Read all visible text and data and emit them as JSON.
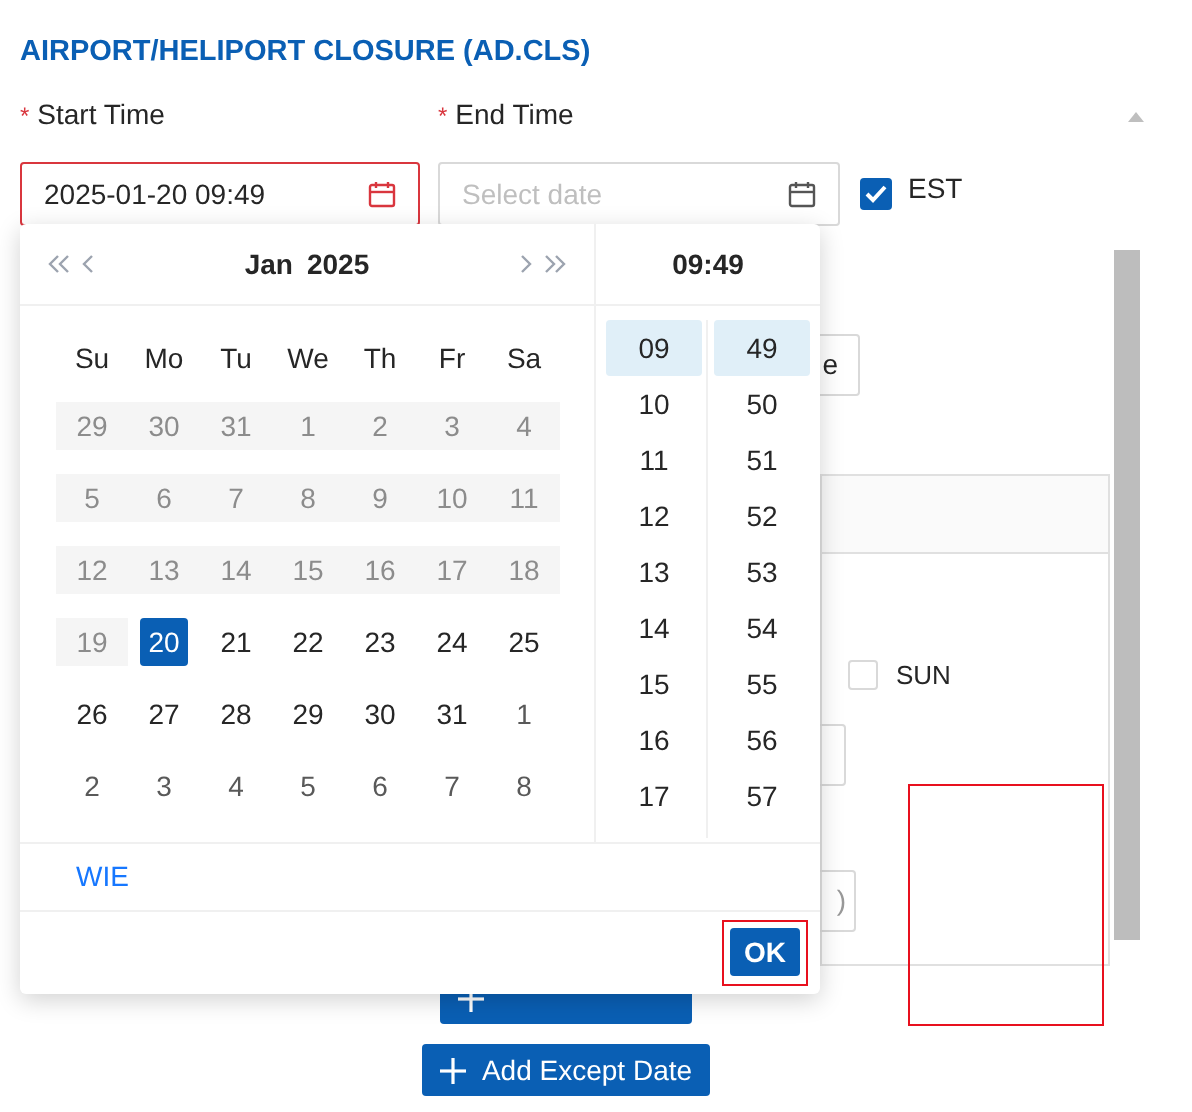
{
  "section": {
    "title": "AIRPORT/HELIPORT CLOSURE (AD.CLS)"
  },
  "fields": [
    {
      "label": "Start Time",
      "required_mark": "*",
      "value": "2025-01-20 09:49",
      "error": true
    },
    {
      "label": "End Time",
      "required_mark": "*",
      "placeholder": "Select date",
      "error": false
    }
  ],
  "est": {
    "label": "EST",
    "checked": true
  },
  "background": {
    "button_text": "e",
    "checkbox": {
      "label": "SUN",
      "checked": false
    },
    "field_text": ")"
  },
  "buttons": [
    {
      "label": "Add Except Date"
    }
  ],
  "picker": {
    "month": "Jan",
    "year": "2025",
    "time": "09:49",
    "weekdays": [
      "Su",
      "Mo",
      "Tu",
      "We",
      "Th",
      "Fr",
      "Sa"
    ],
    "weeks": [
      [
        {
          "day": "29",
          "kind": "disabled",
          "selected": false
        },
        {
          "day": "30",
          "kind": "disabled",
          "selected": false
        },
        {
          "day": "31",
          "kind": "disabled",
          "selected": false
        },
        {
          "day": "1",
          "kind": "disabled",
          "selected": false
        },
        {
          "day": "2",
          "kind": "disabled",
          "selected": false
        },
        {
          "day": "3",
          "kind": "disabled",
          "selected": false
        },
        {
          "day": "4",
          "kind": "disabled",
          "selected": false
        }
      ],
      [
        {
          "day": "5",
          "kind": "disabled",
          "selected": false
        },
        {
          "day": "6",
          "kind": "disabled",
          "selected": false
        },
        {
          "day": "7",
          "kind": "disabled",
          "selected": false
        },
        {
          "day": "8",
          "kind": "disabled",
          "selected": false
        },
        {
          "day": "9",
          "kind": "disabled",
          "selected": false
        },
        {
          "day": "10",
          "kind": "disabled",
          "selected": false
        },
        {
          "day": "11",
          "kind": "disabled",
          "selected": false
        }
      ],
      [
        {
          "day": "12",
          "kind": "disabled",
          "selected": false
        },
        {
          "day": "13",
          "kind": "disabled",
          "selected": false
        },
        {
          "day": "14",
          "kind": "disabled",
          "selected": false
        },
        {
          "day": "15",
          "kind": "disabled",
          "selected": false
        },
        {
          "day": "16",
          "kind": "disabled",
          "selected": false
        },
        {
          "day": "17",
          "kind": "disabled",
          "selected": false
        },
        {
          "day": "18",
          "kind": "disabled",
          "selected": false
        }
      ],
      [
        {
          "day": "19",
          "kind": "disabled",
          "selected": false
        },
        {
          "day": "20",
          "kind": "current",
          "selected": true
        },
        {
          "day": "21",
          "kind": "current",
          "selected": false
        },
        {
          "day": "22",
          "kind": "current",
          "selected": false
        },
        {
          "day": "23",
          "kind": "current",
          "selected": false
        },
        {
          "day": "24",
          "kind": "current",
          "selected": false
        },
        {
          "day": "25",
          "kind": "current",
          "selected": false
        }
      ],
      [
        {
          "day": "26",
          "kind": "current",
          "selected": false
        },
        {
          "day": "27",
          "kind": "current",
          "selected": false
        },
        {
          "day": "28",
          "kind": "current",
          "selected": false
        },
        {
          "day": "29",
          "kind": "current",
          "selected": false
        },
        {
          "day": "30",
          "kind": "current",
          "selected": false
        },
        {
          "day": "31",
          "kind": "current",
          "selected": false
        },
        {
          "day": "1",
          "kind": "outside",
          "selected": false
        }
      ],
      [
        {
          "day": "2",
          "kind": "outside",
          "selected": false
        },
        {
          "day": "3",
          "kind": "outside",
          "selected": false
        },
        {
          "day": "4",
          "kind": "outside",
          "selected": false
        },
        {
          "day": "5",
          "kind": "outside",
          "selected": false
        },
        {
          "day": "6",
          "kind": "outside",
          "selected": false
        },
        {
          "day": "7",
          "kind": "outside",
          "selected": false
        },
        {
          "day": "8",
          "kind": "outside",
          "selected": false
        }
      ]
    ],
    "hours": [
      {
        "label": "09",
        "selected": true
      },
      {
        "label": "10",
        "selected": false
      },
      {
        "label": "11",
        "selected": false
      },
      {
        "label": "12",
        "selected": false
      },
      {
        "label": "13",
        "selected": false
      },
      {
        "label": "14",
        "selected": false
      },
      {
        "label": "15",
        "selected": false
      },
      {
        "label": "16",
        "selected": false
      },
      {
        "label": "17",
        "selected": false
      }
    ],
    "minutes": [
      {
        "label": "49",
        "selected": true
      },
      {
        "label": "50",
        "selected": false
      },
      {
        "label": "51",
        "selected": false
      },
      {
        "label": "52",
        "selected": false
      },
      {
        "label": "53",
        "selected": false
      },
      {
        "label": "54",
        "selected": false
      },
      {
        "label": "55",
        "selected": false
      },
      {
        "label": "56",
        "selected": false
      },
      {
        "label": "57",
        "selected": false
      }
    ],
    "footer_link": "WIE",
    "ok": "OK"
  }
}
